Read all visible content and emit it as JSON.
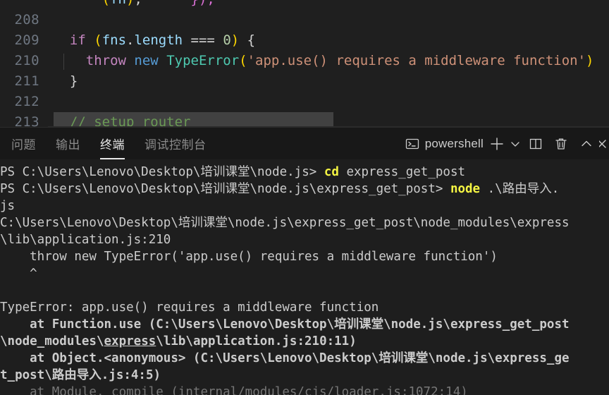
{
  "editor": {
    "language": "javascript",
    "lines": [
      {
        "number": "",
        "cut_off": true,
        "tokens": [
          {
            "t": "      ",
            "c": "tk-plain"
          },
          {
            "t": "(",
            "c": "tk-brkt-y"
          },
          {
            "t": "fn",
            "c": "tk-var"
          },
          {
            "t": ")",
            "c": "tk-brkt-y"
          },
          {
            "t": ";",
            "c": "tk-punc"
          },
          {
            "t": "      ",
            "c": "tk-plain"
          },
          {
            "t": "});",
            "c": "tk-brkt-p"
          }
        ],
        "selected": false
      },
      {
        "number": "208",
        "tokens": [],
        "selected": false
      },
      {
        "number": "209",
        "tokens": [
          {
            "t": "  ",
            "c": "tk-plain"
          },
          {
            "t": "if",
            "c": "tk-key"
          },
          {
            "t": " ",
            "c": "tk-plain"
          },
          {
            "t": "(",
            "c": "tk-brkt-y"
          },
          {
            "t": "fns",
            "c": "tk-var"
          },
          {
            "t": ".",
            "c": "tk-punc"
          },
          {
            "t": "length",
            "c": "tk-var"
          },
          {
            "t": " === ",
            "c": "tk-punc"
          },
          {
            "t": "0",
            "c": "tk-num"
          },
          {
            "t": ")",
            "c": "tk-brkt-y"
          },
          {
            "t": " {",
            "c": "tk-punc"
          }
        ],
        "selected": false
      },
      {
        "number": "210",
        "indent_guide": true,
        "tokens": [
          {
            "t": "    ",
            "c": "tk-plain"
          },
          {
            "t": "throw",
            "c": "tk-key"
          },
          {
            "t": " ",
            "c": "tk-plain"
          },
          {
            "t": "new",
            "c": "tk-ctrl"
          },
          {
            "t": " ",
            "c": "tk-plain"
          },
          {
            "t": "TypeError",
            "c": "tk-type"
          },
          {
            "t": "(",
            "c": "tk-brkt-y"
          },
          {
            "t": "'app.use() requires a middleware function'",
            "c": "tk-str"
          },
          {
            "t": ")",
            "c": "tk-brkt-y"
          }
        ],
        "selected": false
      },
      {
        "number": "211",
        "tokens": [
          {
            "t": "  }",
            "c": "tk-punc"
          }
        ],
        "selected": false
      },
      {
        "number": "212",
        "tokens": [],
        "selected": false
      },
      {
        "number": "213",
        "tokens": [
          {
            "t": "  // setup router",
            "c": "tk-com"
          }
        ],
        "selected": true,
        "selection_width": 473
      }
    ]
  },
  "panel": {
    "tabs": [
      {
        "label": "问题",
        "active": false,
        "name": "tab-problems"
      },
      {
        "label": "输出",
        "active": false,
        "name": "tab-output"
      },
      {
        "label": "终端",
        "active": true,
        "name": "tab-terminal"
      },
      {
        "label": "调试控制台",
        "active": false,
        "name": "tab-debug-console"
      }
    ],
    "toolbar": {
      "shell_icon": "terminal-icon",
      "shell_label": "powershell",
      "new_terminal_icon": "plus-icon",
      "new_terminal_dropdown_icon": "chevron-down-icon",
      "split_terminal_icon": "split-editor-icon",
      "kill_terminal_icon": "trash-icon",
      "collapse_panel_icon": "chevron-up-icon",
      "close_panel_icon": "close-icon"
    }
  },
  "terminal": {
    "lines": [
      {
        "name": "prompt-line-cd",
        "segments": [
          {
            "t": "PS C:\\Users\\Lenovo\\Desktop\\培训课堂\\node.js> ",
            "c": "t-dim"
          },
          {
            "t": "cd",
            "c": "t-cmd"
          },
          {
            "t": " express_get_post",
            "c": "t-dim"
          }
        ]
      },
      {
        "name": "prompt-line-node",
        "segments": [
          {
            "t": "PS C:\\Users\\Lenovo\\Desktop\\培训课堂\\node.js\\express_get_post> ",
            "c": "t-dim"
          },
          {
            "t": "node",
            "c": "t-cmd"
          },
          {
            "t": " .\\路由导入.",
            "c": "t-dim"
          }
        ]
      },
      {
        "name": "prompt-line-wrap",
        "segments": [
          {
            "t": "js",
            "c": "t-dim"
          }
        ]
      },
      {
        "name": "error-path-line-1",
        "segments": [
          {
            "t": "C:\\Users\\Lenovo\\Desktop\\培训课堂\\node.js\\express_get_post\\node_modules\\express",
            "c": "t-dim"
          }
        ]
      },
      {
        "name": "error-path-line-2",
        "segments": [
          {
            "t": "\\lib\\application.js:210",
            "c": "t-dim"
          }
        ]
      },
      {
        "name": "error-source-line",
        "segments": [
          {
            "t": "    throw new TypeError('app.use() requires a middleware function')",
            "c": "t-dim"
          }
        ]
      },
      {
        "name": "error-caret-line",
        "segments": [
          {
            "t": "    ^",
            "c": "t-dim"
          }
        ]
      },
      {
        "name": "blank-line",
        "segments": [
          {
            "t": " ",
            "c": "t-dim"
          }
        ]
      },
      {
        "name": "error-message-line",
        "segments": [
          {
            "t": "TypeError: app.use() requires a middleware function",
            "c": "t-dim"
          }
        ]
      },
      {
        "name": "stack-line-1",
        "segments": [
          {
            "t": "    at Function.use (C:\\Users\\Lenovo\\Desktop\\培训课堂\\node.js\\express_get_post",
            "c": "t-bold"
          }
        ]
      },
      {
        "name": "stack-line-1-wrap",
        "segments": [
          {
            "t": "\\node_modules\\",
            "c": "t-bold"
          },
          {
            "t": "express",
            "c": "t-bold t-link"
          },
          {
            "t": "\\lib\\application.js:210:11)",
            "c": "t-bold"
          }
        ]
      },
      {
        "name": "stack-line-2",
        "segments": [
          {
            "t": "    at Object.<anonymous> (C:\\Users\\Lenovo\\Desktop\\培训课堂\\node.js\\express_ge",
            "c": "t-bold"
          }
        ]
      },
      {
        "name": "stack-line-2-wrap",
        "segments": [
          {
            "t": "t_post\\路由导入.js:4:5)",
            "c": "t-bold"
          }
        ]
      },
      {
        "name": "stack-line-3",
        "segments": [
          {
            "t": "    at Module._compile (internal/modules/cjs/loader.js:1072:14)",
            "c": "t-fade"
          }
        ]
      }
    ]
  },
  "colors": {
    "editor_bg": "#1f1f1f",
    "terminal_bg": "#1e1e1e",
    "tabbar_bg": "#181818",
    "selection": "#414141",
    "command_yellow": "#f5f543",
    "accent": "#e7e7e7"
  }
}
